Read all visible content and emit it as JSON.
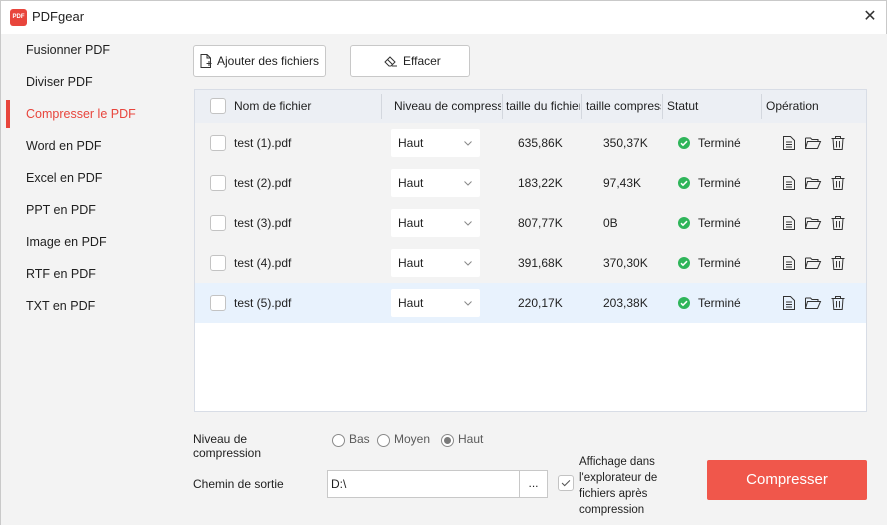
{
  "app": {
    "title": "PDFgear",
    "logo_text": "PDF",
    "close": "✕"
  },
  "sidebar": {
    "active_index": 2,
    "items": [
      {
        "label": "Fusionner PDF"
      },
      {
        "label": "Diviser PDF"
      },
      {
        "label": "Compresser le PDF"
      },
      {
        "label": "Word en PDF"
      },
      {
        "label": "Excel en PDF"
      },
      {
        "label": "PPT en PDF"
      },
      {
        "label": "Image en PDF"
      },
      {
        "label": "RTF en PDF"
      },
      {
        "label": "TXT en PDF"
      }
    ]
  },
  "toolbar": {
    "add_label": "Ajouter des fichiers",
    "clear_label": "Effacer"
  },
  "table": {
    "headers": {
      "name": "Nom de fichier",
      "level": "Niveau de compression",
      "size": "taille du fichier",
      "compressed": "taille compressée",
      "status": "Statut",
      "operation": "Opération"
    },
    "rows": [
      {
        "name": "test (1).pdf",
        "level": "Haut",
        "size": "635,86K",
        "compressed": "350,37K",
        "status": "Terminé"
      },
      {
        "name": "test (2).pdf",
        "level": "Haut",
        "size": "183,22K",
        "compressed": "97,43K",
        "status": "Terminé"
      },
      {
        "name": "test (3).pdf",
        "level": "Haut",
        "size": "807,77K",
        "compressed": "0B",
        "status": "Terminé"
      },
      {
        "name": "test (4).pdf",
        "level": "Haut",
        "size": "391,68K",
        "compressed": "370,30K",
        "status": "Terminé"
      },
      {
        "name": "test (5).pdf",
        "level": "Haut",
        "size": "220,17K",
        "compressed": "203,38K",
        "status": "Terminé"
      }
    ],
    "selected_row": 4
  },
  "options": {
    "level_label": "Niveau de compression",
    "levels": [
      "Bas",
      "Moyen",
      "Haut"
    ],
    "selected_level": "Haut",
    "path_label": "Chemin de sortie",
    "path_value": "D:\\",
    "browse_label": "...",
    "explorer_label": "Affichage dans l'explorateur de fichiers après compression",
    "explorer_checked": true
  },
  "compress_label": "Compresser",
  "colors": {
    "accent": "#f0574b",
    "success": "#2fb55a",
    "selected_row": "#e8f2fd"
  }
}
